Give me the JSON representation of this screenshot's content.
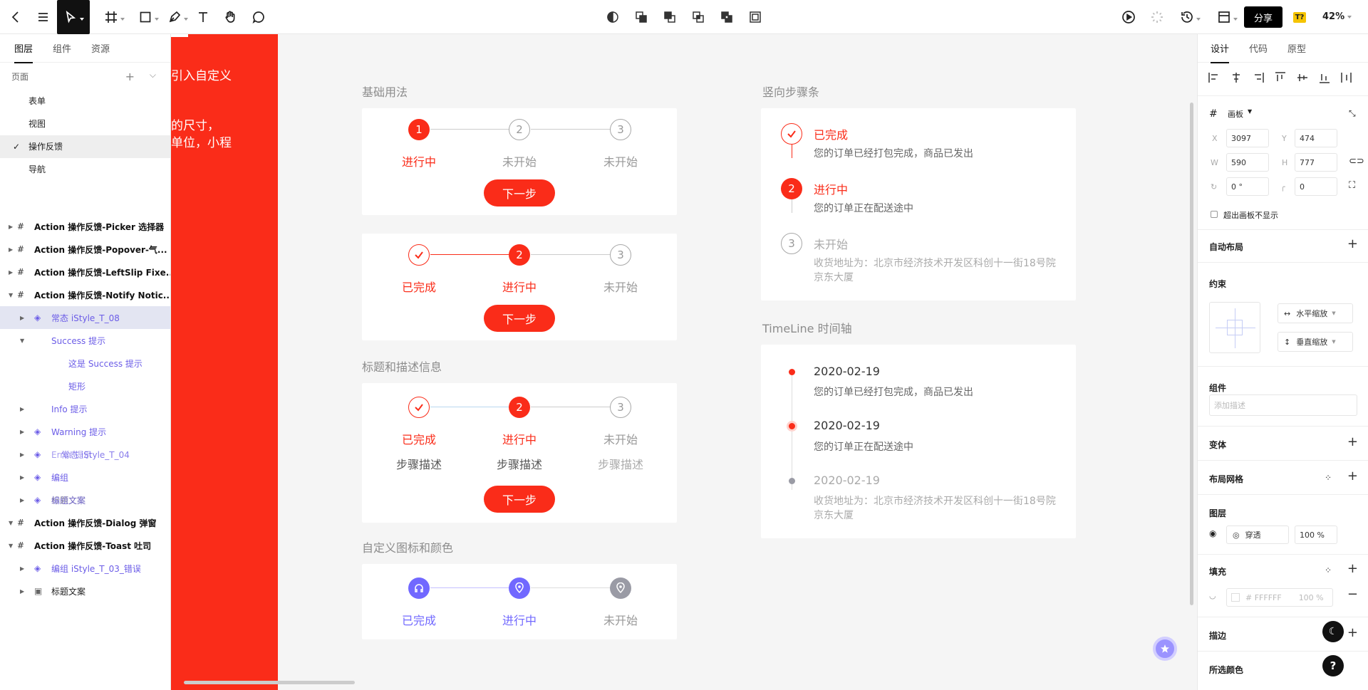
{
  "toolbar": {
    "share_label": "分享",
    "badge": "T?",
    "zoom": "42%"
  },
  "left_panel": {
    "tabs": [
      "图层",
      "组件",
      "资源"
    ],
    "pages_label": "页面",
    "pages": [
      "表单",
      "视图",
      "操作反馈",
      "导航"
    ],
    "layers": [
      "Action 操作反馈-Picker 选择器",
      "Action 操作反馈-Popover-气...",
      "Action 操作反馈-LeftSlip Fixe...",
      "Action 操作反馈-Notify Notic...",
      "常态 iStyle_T_08",
      "Success 提示",
      "这是 Success 提示",
      "矩形",
      "Info 提示",
      "Warning 提示",
      "Error 提示",
      "常态 iStyle_T_04",
      "编组",
      "标题文案",
      "编组文案",
      "Action 操作反馈-Dialog 弹窗",
      "Action 操作反馈-Toast 吐司",
      "编组 iStyle_T_03_错误",
      "标题文案"
    ]
  },
  "canvas": {
    "red_panel_lines": [
      "引入自定义",
      "的尺寸，",
      "单位，小程"
    ],
    "basic": {
      "title": "基础用法",
      "row1": {
        "nums": [
          "1",
          "2",
          "3"
        ],
        "labels": [
          "进行中",
          "未开始",
          "未开始"
        ]
      },
      "row2": {
        "nums": [
          "2",
          "3"
        ],
        "labels": [
          "已完成",
          "进行中",
          "未开始"
        ]
      },
      "next": "下一步"
    },
    "titled": {
      "title": "标题和描述信息",
      "nums": [
        "2",
        "3"
      ],
      "labels": [
        "已完成",
        "进行中",
        "未开始"
      ],
      "descs": [
        "步骤描述",
        "步骤描述",
        "步骤描述"
      ],
      "next": "下一步"
    },
    "custom": {
      "title": "自定义图标和颜色",
      "labels": [
        "已完成",
        "进行中",
        "未开始"
      ]
    },
    "vertical": {
      "title": "竖向步骤条",
      "steps": [
        {
          "num": "",
          "title": "已完成",
          "desc": "您的订单已经打包完成，商品已发出"
        },
        {
          "num": "2",
          "title": "进行中",
          "desc": "您的订单正在配送途中"
        },
        {
          "num": "3",
          "title": "未开始",
          "desc": "收货地址为：北京市经济技术开发区科创十一街18号院京东大厦"
        }
      ]
    },
    "timeline": {
      "title": "TimeLine 时间轴",
      "items": [
        {
          "date": "2020-02-19",
          "desc": "您的订单已经打包完成，商品已发出"
        },
        {
          "date": "2020-02-19",
          "desc": "您的订单正在配送途中"
        },
        {
          "date": "2020-02-19",
          "desc": "收货地址为：北京市经济技术开发区科创十一街18号院京东大厦"
        }
      ]
    }
  },
  "right_panel": {
    "tabs": [
      "设计",
      "代码",
      "原型"
    ],
    "frame_label": "画板",
    "x_label": "X",
    "x": "3097",
    "y_label": "Y",
    "y": "474",
    "w_label": "W",
    "w": "590",
    "h_label": "H",
    "h": "777",
    "rotation": "0 °",
    "radius": "0",
    "clip_label": "超出画板不显示",
    "auto_layout": "自动布局",
    "constraints": "约束",
    "h_constraint": "水平缩放",
    "v_constraint": "垂直缩放",
    "component": "组件",
    "desc_placeholder": "添加描述",
    "variant": "变体",
    "layout_grid": "布局网格",
    "layer": "图层",
    "blend": "穿透",
    "opacity": "100 %",
    "fill": "填充",
    "fill_color": "# FFFFFF",
    "fill_opacity": "100 %",
    "stroke": "描边",
    "selected_colors": "所选颜色"
  },
  "colors": {
    "brand_red": "#fa2c19",
    "purple": "#7168ff",
    "grey_icon": "#9a9ba5"
  }
}
